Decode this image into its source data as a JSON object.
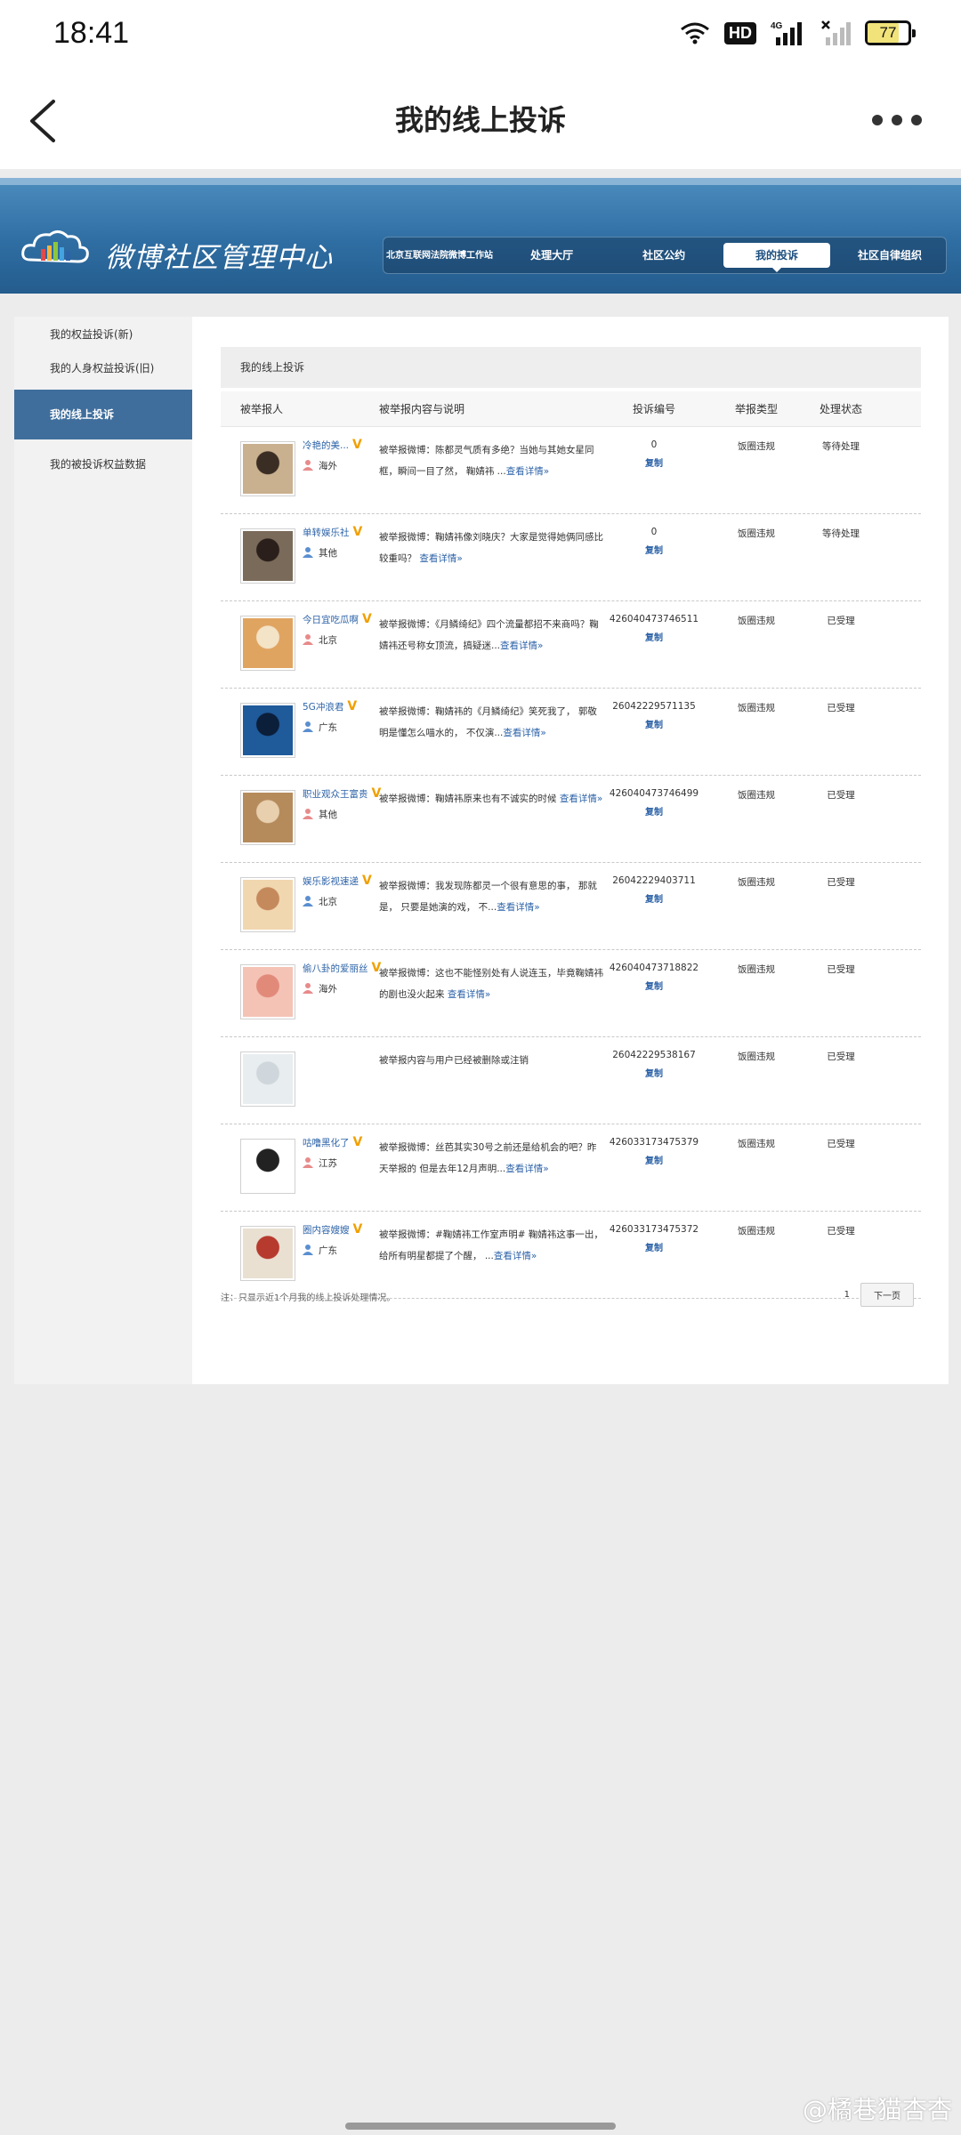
{
  "status_bar": {
    "time": "18:41",
    "network": "4G",
    "hd": "HD",
    "battery": "77",
    "battery_level": 0.77
  },
  "app_bar": {
    "title": "我的线上投诉"
  },
  "banner": {
    "site_title": "微博社区管理中心",
    "nav": [
      {
        "label": "北京互联网法院微博工作站"
      },
      {
        "label": "处理大厅"
      },
      {
        "label": "社区公约"
      },
      {
        "label": "我的投诉"
      },
      {
        "label": "社区自律组织"
      }
    ]
  },
  "sidebar": {
    "items": [
      {
        "label": "我的权益投诉(新)"
      },
      {
        "label": "我的人身权益投诉(旧)"
      },
      {
        "label": "我的线上投诉"
      },
      {
        "label": "我的被投诉权益数据"
      }
    ]
  },
  "section": {
    "title": "我的线上投诉"
  },
  "table": {
    "columns": [
      "被举报人",
      "被举报内容与说明",
      "投诉编号",
      "举报类型",
      "处理状态"
    ],
    "rows": [
      {
        "name": "冷艳的美...",
        "location": "海外",
        "desc": "被举报微博：陈都灵气质有多绝？当她与其她女星同框，瞬间一目了然，  鞠婧祎 ...",
        "more": "查看详情»",
        "number": "0",
        "copy": "复制",
        "type": "饭圈违规",
        "status": "等待处理"
      },
      {
        "name": "单转娱乐社",
        "location": "其他",
        "desc": "被举报微博：鞠婧祎像刘晓庆？大家是觉得她俩同感比较重吗？  ",
        "more": "查看详情»",
        "number": "0",
        "copy": "复制",
        "type": "饭圈违规",
        "status": "等待处理"
      },
      {
        "name": "今日宜吃瓜啊",
        "location": "北京",
        "desc": "被举报微博：《月鳞绮纪》四个流量都招不来商吗？鞠婧祎还号称女顶流，搞疑迷...",
        "more": "查看详情»",
        "number": "426040473746511",
        "copy": "复制",
        "type": "饭圈违规",
        "status": "已受理"
      },
      {
        "name": "5G冲浪君",
        "location": "广东",
        "desc": "被举报微博：鞠婧祎的《月鳞绮纪》笑死我了，  郭敬明是懂怎么喵水的，  不仅演...",
        "more": "查看详情»",
        "number": "26042229571135",
        "copy": "复制",
        "type": "饭圈违规",
        "status": "已受理"
      },
      {
        "name": "职业观众王富贵",
        "location": "其他",
        "desc": "被举报微博：鞠婧祎原来也有不诚实的时候  ",
        "more": "查看详情»",
        "number": "426040473746499",
        "copy": "复制",
        "type": "饭圈违规",
        "status": "已受理"
      },
      {
        "name": "娱乐影视速递",
        "location": "北京",
        "desc": "被举报微博：我发现陈都灵一个很有意思的事，  那就是，  只要是她演的戏，  不...",
        "more": "查看详情»",
        "number": "26042229403711",
        "copy": "复制",
        "type": "饭圈违规",
        "status": "已受理"
      },
      {
        "name": "偷八卦的爱丽丝",
        "location": "海外",
        "desc": "被举报微博：这也不能怪别处有人说连玉，毕竟鞠婧祎的剧也没火起来  ",
        "more": "查看详情»",
        "number": "426040473718822",
        "copy": "复制",
        "type": "饭圈违规",
        "status": "已受理"
      },
      {
        "name": "",
        "location": "",
        "desc": "被举报内容与用户已经被删除或注销",
        "more": "",
        "number": "26042229538167",
        "copy": "复制",
        "type": "饭圈违规",
        "status": "已受理"
      },
      {
        "name": "咕噜黑化了",
        "location": "江苏",
        "desc": "被举报微博：丝芭其实30号之前还是给机会的吧？昨天举报的  但是去年12月声明...",
        "more": "查看详情»",
        "number": "426033173475379",
        "copy": "复制",
        "type": "饭圈违规",
        "status": "已受理"
      },
      {
        "name": "圈内容嫂嫂",
        "location": "广东",
        "desc": "被举报微博：#鞠婧祎工作室声明# 鞠婧祎这事一出，  给所有明星都提了个醒，  ...",
        "more": "查看详情»",
        "number": "426033173475372",
        "copy": "复制",
        "type": "饭圈违规",
        "status": "已受理"
      }
    ]
  },
  "footer": {
    "note": "注：只显示近1个月我的线上投诉处理情况。",
    "page": "1",
    "next": "下一页"
  },
  "watermark": "@橘巷猫杏杏",
  "colors": {
    "accent": "#2d63a8",
    "banner": "#2f6ea3",
    "sidebar_active": "#3f6e9c",
    "verified": "#f0a000"
  }
}
